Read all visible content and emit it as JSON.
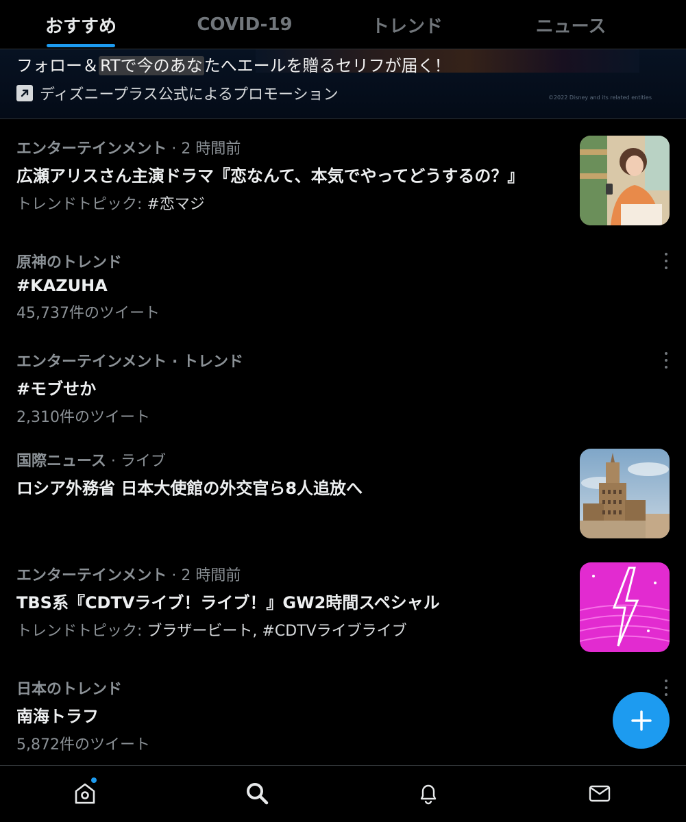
{
  "tabs": [
    {
      "label": "おすすめ",
      "active": true
    },
    {
      "label": "COVID-19",
      "active": false
    },
    {
      "label": "トレンド",
      "active": false
    },
    {
      "label": "ニュース",
      "active": false
    }
  ],
  "promo": {
    "title_prefix": "フォロー＆",
    "title_highlight": "RTで今のあな",
    "title_suffix": "たへエールを贈るセリフが届く！",
    "sponsor": "ディズニープラス公式によるプロモーション",
    "copyright": "©2022 Disney and its related entities",
    "icon": "promoted-arrow-icon"
  },
  "trends": [
    {
      "category": "エンターテインメント",
      "meta_suffix": " · 2 時間前",
      "title": "広瀬アリスさん主演ドラマ『恋なんて、本気でやってどうするの？』",
      "sub_label": "トレンドトピック: ",
      "sub_tags": "#恋マジ",
      "thumbnail": "drama-scene-thumbnail"
    },
    {
      "category": "原神のトレンド",
      "meta_suffix": "",
      "title": "#KAZUHA",
      "sub_label": "45,737件のツイート",
      "sub_tags": ""
    },
    {
      "category": "エンターテインメント · トレンド",
      "meta_suffix": "",
      "title": "#モブせか",
      "sub_label": "2,310件のツイート",
      "sub_tags": ""
    },
    {
      "category": "国際ニュース",
      "meta_suffix": " · ライブ",
      "title": "ロシア外務省 日本大使館の外交官ら8人追放へ",
      "sub_label": "",
      "sub_tags": "",
      "thumbnail": "moscow-building-thumbnail"
    },
    {
      "category": "エンターテインメント",
      "meta_suffix": " · 2 時間前",
      "title": "TBS系『CDTVライブ！ライブ！』GW2時間スペシャル",
      "sub_label": "トレンドトピック: ",
      "sub_tags": "ブラザービート, #CDTVライブライブ",
      "thumbnail": "cdtv-logo-thumbnail"
    },
    {
      "category": "日本のトレンド",
      "meta_suffix": "",
      "title": "南海トラフ",
      "sub_label": "5,872件のツイート",
      "sub_tags": ""
    }
  ],
  "colors": {
    "accent": "#1d9bf0",
    "background": "#000000",
    "primary_text": "#e7e9ea",
    "secondary_text": "#71767b"
  },
  "bottom_nav": [
    "home-icon",
    "search-icon",
    "bell-icon",
    "envelope-icon"
  ],
  "fab": "plus-icon"
}
